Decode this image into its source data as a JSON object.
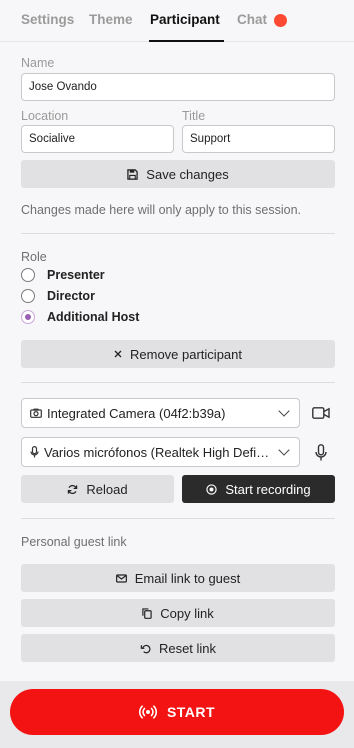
{
  "tabs": [
    {
      "label": "Settings"
    },
    {
      "label": "Theme"
    },
    {
      "label": "Participant"
    },
    {
      "label": "Chat"
    }
  ],
  "active_tab": "Participant",
  "colors": {
    "accent": "#f31312",
    "chat_badge": "#ff4a33",
    "radio_selected": "#9b5fb4"
  },
  "form": {
    "name_label": "Name",
    "name_value": "Jose Ovando",
    "location_label": "Location",
    "location_value": "Socialive",
    "title_label": "Title",
    "title_value": "Support",
    "save_label": "Save changes",
    "note": "Changes made here will only apply to this session."
  },
  "role": {
    "label": "Role",
    "options": [
      {
        "label": "Presenter",
        "checked": false
      },
      {
        "label": "Director",
        "checked": false
      },
      {
        "label": "Additional Host",
        "checked": true
      }
    ]
  },
  "remove_label": "Remove participant",
  "devices": {
    "camera": "Integrated Camera (04f2:b39a)",
    "microphone": "Varios micrófonos (Realtek High Definition Audio)",
    "camera_icon": "video-camera-icon",
    "microphone_icon": "microphone-icon"
  },
  "actions": {
    "reload": "Reload",
    "record": "Start recording"
  },
  "guest_link": {
    "label": "Personal guest link",
    "email": "Email link to guest",
    "copy": "Copy link",
    "reset": "Reset link"
  },
  "start_label": "START"
}
